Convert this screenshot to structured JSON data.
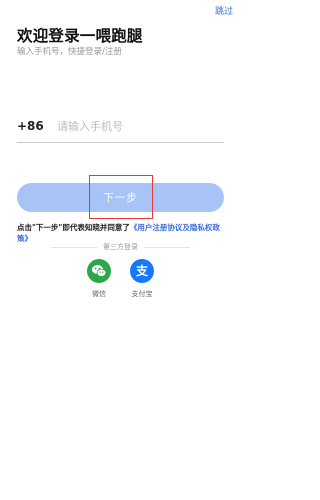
{
  "header": {
    "skip_label": "跳过",
    "title": "欢迎登录一喂跑腿",
    "subtitle": "输入手机号，快捷登录/注册"
  },
  "phone": {
    "country_code": "+86",
    "placeholder": "请输入手机号",
    "value": ""
  },
  "next_button": {
    "label": "下一步",
    "color": "#a8c3f5"
  },
  "agreement": {
    "prefix": "点击\"下一步\"即代表知晓并同意了",
    "link_text": "《用户注册协议及隐私权政策》"
  },
  "third_party": {
    "label": "第三方登录",
    "options": [
      {
        "label": "微信",
        "icon": "wechat-icon",
        "color": "#2ea64a"
      },
      {
        "label": "支付宝",
        "icon": "alipay-icon",
        "color": "#1677ff"
      }
    ]
  },
  "colors": {
    "link": "#3d6fd8",
    "highlight": "#e53935"
  }
}
